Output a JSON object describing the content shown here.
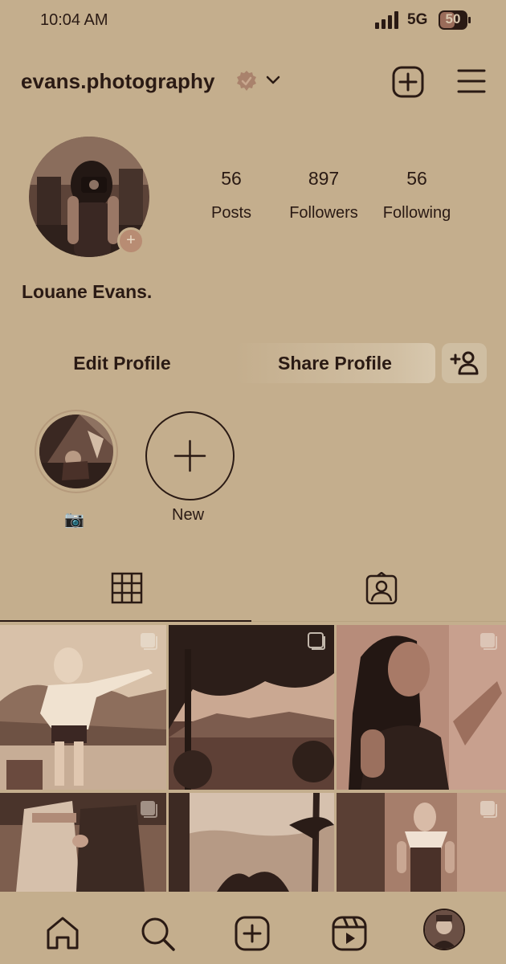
{
  "status_bar": {
    "time": "10:04 AM",
    "network": "5G",
    "battery": "50"
  },
  "header": {
    "username": "evans.photography"
  },
  "profile": {
    "name": "Louane Evans.",
    "stats": [
      {
        "value": "56",
        "label": "Posts"
      },
      {
        "value": "897",
        "label": "Followers"
      },
      {
        "value": "56",
        "label": "Following"
      }
    ]
  },
  "actions": {
    "edit": "Edit Profile",
    "share": "Share Profile"
  },
  "highlights": {
    "first_label": "📷",
    "new_label": "New"
  },
  "colors": {
    "background": "#c4ae8d",
    "text": "#2a1a14",
    "accent": "#b88c73"
  },
  "icons": [
    "verified-badge-icon",
    "chevron-down-icon",
    "create-post-icon",
    "menu-icon",
    "grid-icon",
    "tagged-icon",
    "home-icon",
    "search-icon",
    "add-icon",
    "reels-icon"
  ]
}
